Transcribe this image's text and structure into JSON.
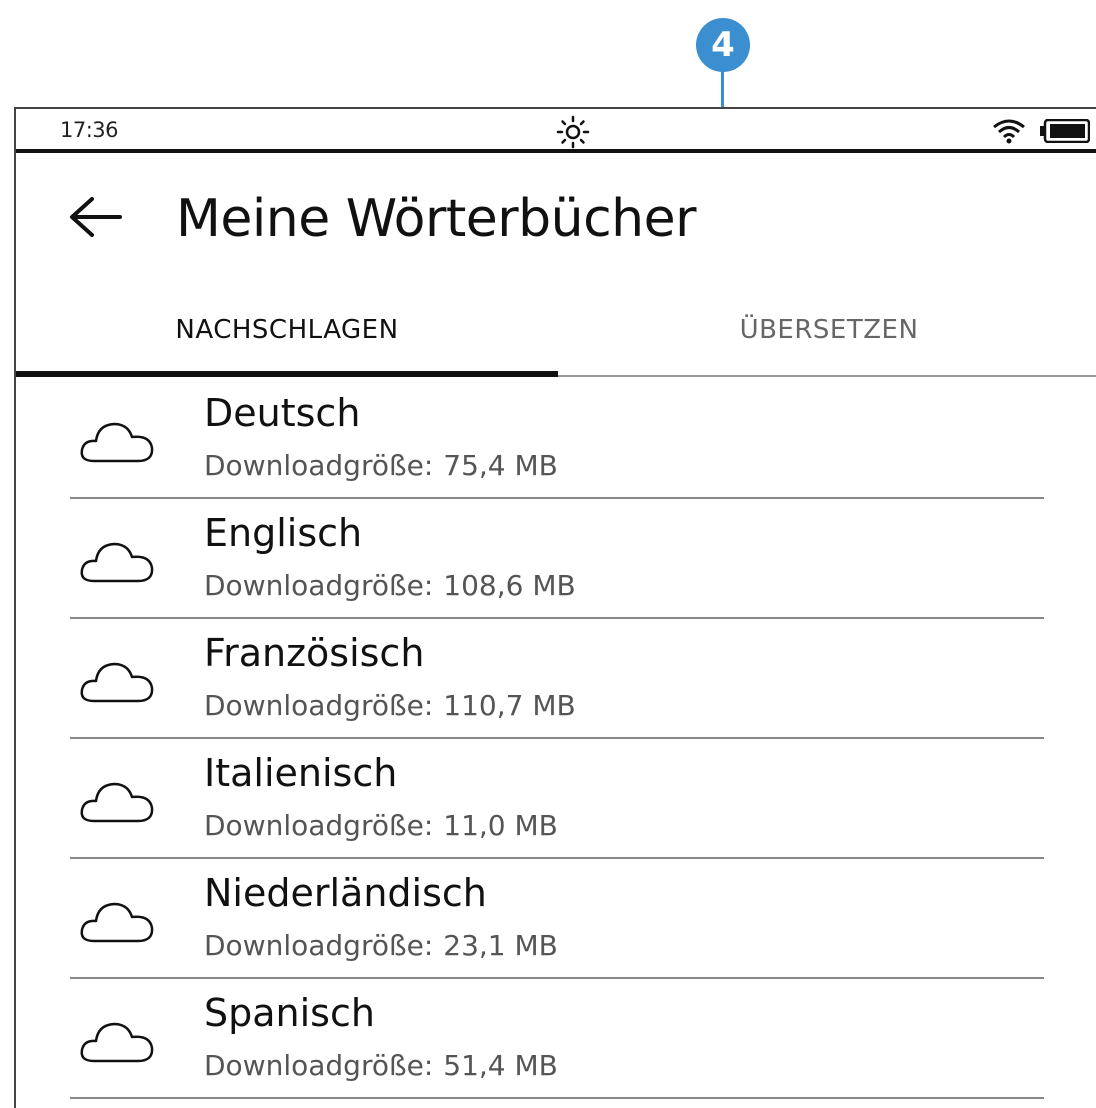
{
  "annotation": {
    "number": "4"
  },
  "status": {
    "time": "17:36",
    "icons": [
      "frontlight-icon",
      "wifi-icon",
      "battery-icon"
    ]
  },
  "header": {
    "title": "Meine Wörterbücher"
  },
  "tabs": [
    {
      "label": "NACHSCHLAGEN",
      "active": true
    },
    {
      "label": "ÜBERSETZEN",
      "active": false
    }
  ],
  "dictionaries": [
    {
      "name": "Deutsch",
      "size_label": "Downloadgröße:",
      "size": "75,4 MB",
      "icon": "cloud-icon"
    },
    {
      "name": "Englisch",
      "size_label": "Downloadgröße:",
      "size": "108,6 MB",
      "icon": "cloud-icon"
    },
    {
      "name": "Französisch",
      "size_label": "Downloadgröße:",
      "size": "110,7 MB",
      "icon": "cloud-icon"
    },
    {
      "name": "Italienisch",
      "size_label": "Downloadgröße:",
      "size": "11,0 MB",
      "icon": "cloud-icon"
    },
    {
      "name": "Niederländisch",
      "size_label": "Downloadgröße:",
      "size": "23,1 MB",
      "icon": "cloud-icon"
    },
    {
      "name": "Spanisch",
      "size_label": "Downloadgröße:",
      "size": "51,4 MB",
      "icon": "cloud-icon"
    }
  ],
  "colors": {
    "callout": "#3b8fd1",
    "text": "#111111",
    "secondary_text": "#555555"
  }
}
